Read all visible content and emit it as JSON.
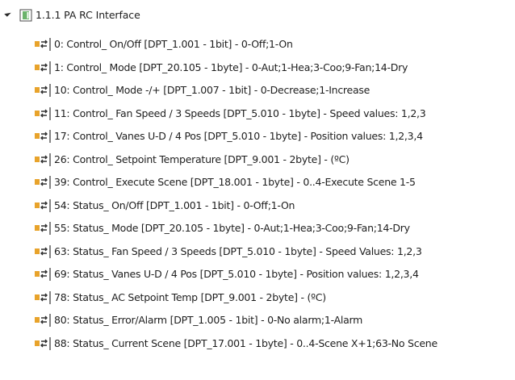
{
  "tree": {
    "expander_icon": "expanded-triangle-icon",
    "root": {
      "label": "1.1.1  PA RC Interface",
      "icon": "device-icon"
    },
    "items": [
      {
        "label": "0: Control_ On/Off [DPT_1.001 - 1bit] - 0-Off;1-On",
        "icon": "communication-object-icon"
      },
      {
        "label": "1: Control_ Mode [DPT_20.105 - 1byte] - 0-Aut;1-Hea;3-Coo;9-Fan;14-Dry",
        "icon": "communication-object-icon"
      },
      {
        "label": "10: Control_ Mode -/+ [DPT_1.007 - 1bit] - 0-Decrease;1-Increase",
        "icon": "communication-object-icon"
      },
      {
        "label": "11: Control_ Fan Speed / 3 Speeds [DPT_5.010 - 1byte]  - Speed values: 1,2,3",
        "icon": "communication-object-icon"
      },
      {
        "label": "17: Control_ Vanes U-D / 4 Pos [DPT_5.010 - 1byte] - Position values: 1,2,3,4",
        "icon": "communication-object-icon"
      },
      {
        "label": "26: Control_ Setpoint Temperature [DPT_9.001 - 2byte] - (ºC)",
        "icon": "communication-object-icon"
      },
      {
        "label": "39: Control_ Execute Scene [DPT_18.001 - 1byte] - 0..4-Execute Scene 1-5",
        "icon": "communication-object-icon"
      },
      {
        "label": "54: Status_ On/Off [DPT_1.001 - 1bit] - 0-Off;1-On",
        "icon": "communication-object-icon"
      },
      {
        "label": "55: Status_ Mode [DPT_20.105 - 1byte] - 0-Aut;1-Hea;3-Coo;9-Fan;14-Dry",
        "icon": "communication-object-icon"
      },
      {
        "label": "63: Status_ Fan Speed / 3 Speeds [DPT_5.010 - 1byte] - Speed Values: 1,2,3",
        "icon": "communication-object-icon"
      },
      {
        "label": "69: Status_ Vanes U-D / 4 Pos [DPT_5.010 - 1byte] - Position values: 1,2,3,4",
        "icon": "communication-object-icon"
      },
      {
        "label": "78: Status_ AC Setpoint Temp [DPT_9.001 - 2byte] - (ºC)",
        "icon": "communication-object-icon"
      },
      {
        "label": "80: Status_ Error/Alarm [DPT_1.005 - 1bit] - 0-No alarm;1-Alarm",
        "icon": "communication-object-icon"
      },
      {
        "label": "88: Status_ Current Scene [DPT_17.001 - 1byte] - 0..4-Scene X+1;63-No Scene",
        "icon": "communication-object-icon"
      }
    ]
  },
  "colors": {
    "object_icon_accent": "#e8a32b",
    "object_icon_dark": "#303030",
    "device_icon_green": "#3a9a3a",
    "text": "#1e1e1e"
  }
}
